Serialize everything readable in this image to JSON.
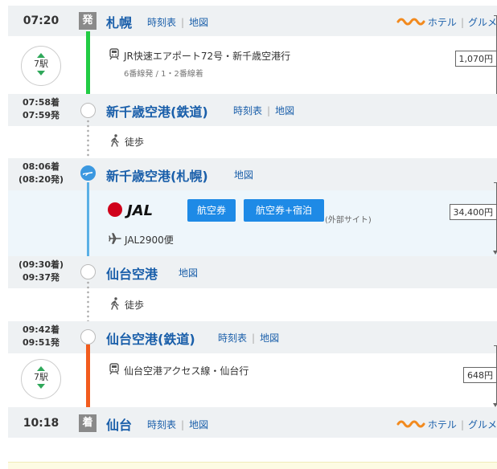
{
  "origin": {
    "time": "07:20",
    "badge": "発",
    "name": "札幌",
    "link_timetable": "時刻表",
    "link_map": "地図",
    "link_hotel": "ホテル",
    "link_gourmet": "グルメ"
  },
  "seg1": {
    "stops": "7駅",
    "train": "JR快速エアポート72号・新千歳空港行",
    "platform": "6番線発 / 1・2番線着",
    "fare": "1,070円",
    "line_color": "#22cc44"
  },
  "st1": {
    "arr": "07:58着",
    "dep": "07:59発",
    "name": "新千歳空港(鉄道)",
    "link_timetable": "時刻表",
    "link_map": "地図"
  },
  "walk1": {
    "label": "徒歩"
  },
  "st2": {
    "arr": "08:06着",
    "dep": "(08:20発)",
    "name": "新千歳空港(札幌)",
    "link_map": "地図"
  },
  "flight": {
    "airline": "JAL",
    "btn_ticket": "航空券",
    "btn_ticket_hotel": "航空券+宿泊",
    "external": "(外部サイト)",
    "flight_no": "JAL2900便",
    "fare": "34,400円",
    "line_color": "#5ab0e6"
  },
  "st3": {
    "arr": "(09:30着)",
    "dep": "09:37発",
    "name": "仙台空港",
    "link_map": "地図"
  },
  "walk2": {
    "label": "徒歩"
  },
  "st4": {
    "arr": "09:42着",
    "dep": "09:51発",
    "name": "仙台空港(鉄道)",
    "link_timetable": "時刻表",
    "link_map": "地図"
  },
  "seg2": {
    "stops": "7駅",
    "train": "仙台空港アクセス線・仙台行",
    "fare": "648円",
    "line_color": "#f25c1e"
  },
  "dest": {
    "time": "10:18",
    "badge": "着",
    "name": "仙台",
    "link_timetable": "時刻表",
    "link_map": "地図",
    "link_hotel": "ホテル",
    "link_gourmet": "グルメ"
  }
}
